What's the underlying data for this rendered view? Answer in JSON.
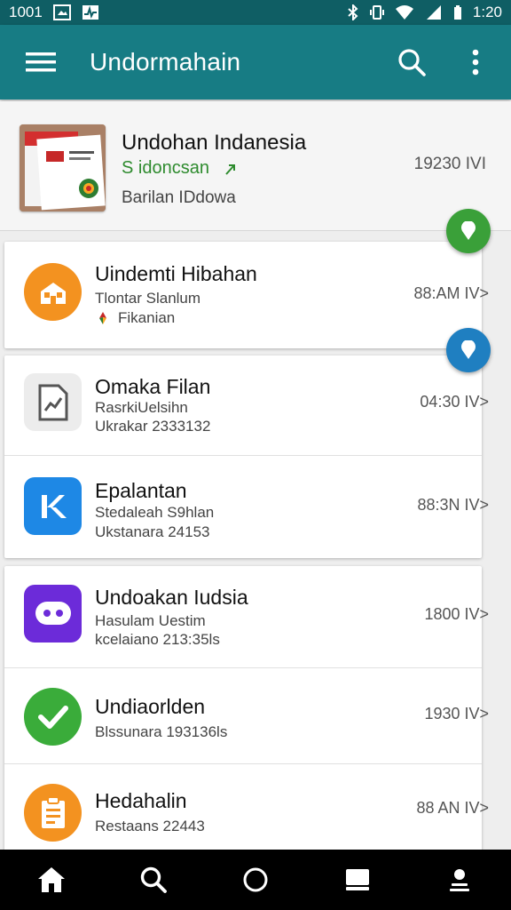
{
  "status_bar": {
    "left_text": "1001",
    "time": "1:20"
  },
  "app_bar": {
    "title": "Undormahain"
  },
  "featured": {
    "title": "Undohan Indanesia",
    "subtitle": "S idoncsan",
    "caption": "Barilan IDdowa",
    "meta": "19230 IVI"
  },
  "items": [
    {
      "title": "Uindemti Hibahan",
      "line1": "Tlontar Slanlum",
      "line2": "Fikanian",
      "meta": "88:AM IV>",
      "icon": "house-icon",
      "color": "#f39220"
    },
    {
      "title": "Omaka Filan",
      "line1": "RasrkiUelsihn",
      "line2": "Ukrakar 2333132",
      "meta": "04:30 IV>",
      "icon": "document-chart-icon",
      "color": "#eeeeee"
    },
    {
      "title": "Epalantan",
      "line1": "Stedaleah S9hlan",
      "line2": "Ukstanara 24153",
      "meta": "88:3N IV>",
      "icon": "k-logo-icon",
      "color": "#1e88e5"
    },
    {
      "title": "Undoakan Iudsia",
      "line1": "Hasulam Uestim",
      "line2": "kcelaiano 213:35ls",
      "meta": "1800 IV>",
      "icon": "chat-bubble-icon",
      "color": "#6c2bd9"
    },
    {
      "title": "Undiaorlden",
      "line1": "Blssunara 193136ls",
      "line2": "",
      "meta": "1930 IV>",
      "icon": "checkmark-icon",
      "color": "#3aac3a"
    },
    {
      "title": "Hedahalin",
      "line1": "Restaans 22443",
      "line2": "",
      "meta": "88 AN IV>",
      "icon": "clipboard-icon",
      "color": "#f39220"
    }
  ],
  "fabs": [
    {
      "icon": "location-pin-icon",
      "color": "#3aa039"
    },
    {
      "icon": "location-pin-icon",
      "color": "#1f7fc1"
    }
  ],
  "bottom_nav": [
    {
      "icon": "home-icon"
    },
    {
      "icon": "search-icon"
    },
    {
      "icon": "circle-icon"
    },
    {
      "icon": "book-icon"
    },
    {
      "icon": "profile-icon"
    }
  ]
}
